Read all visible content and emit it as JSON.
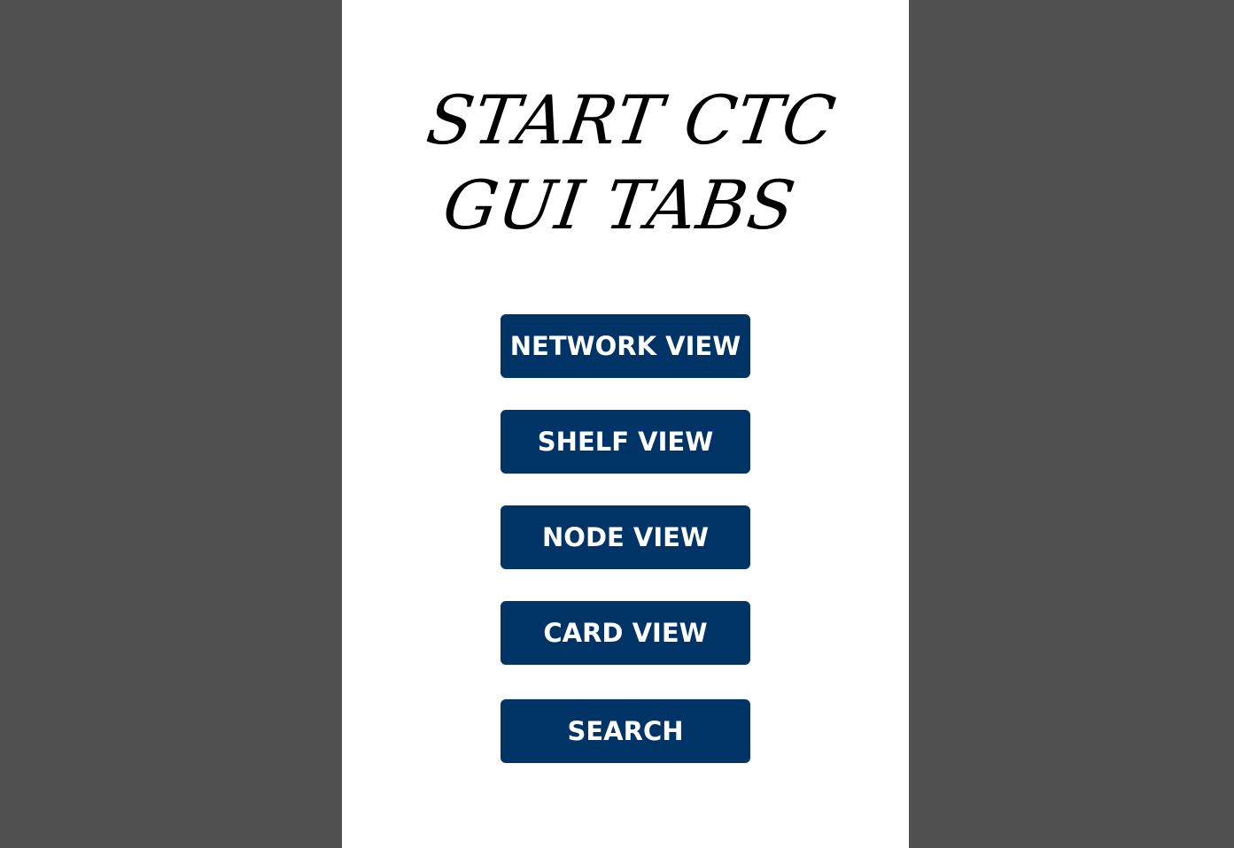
{
  "title": {
    "line1": "START CTC",
    "line2": "GUI TABS"
  },
  "buttons": [
    {
      "label": "NETWORK VIEW"
    },
    {
      "label": "SHELF VIEW"
    },
    {
      "label": "NODE VIEW"
    },
    {
      "label": "CARD VIEW"
    },
    {
      "label": "SEARCH"
    }
  ],
  "colors": {
    "background": "#505050",
    "panel": "#ffffff",
    "button": "#003366",
    "button_text": "#ffffff",
    "title_text": "#000000"
  }
}
